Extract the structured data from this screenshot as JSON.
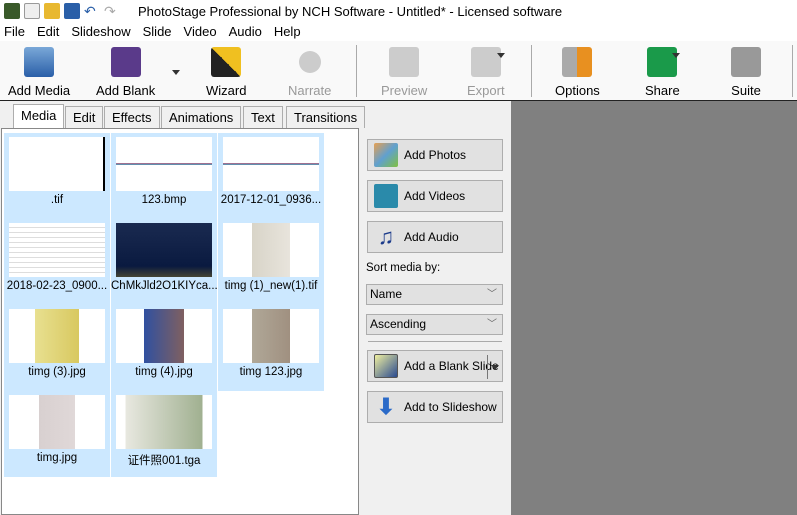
{
  "window": {
    "title": "PhotoStage Professional by NCH Software - Untitled* - Licensed software"
  },
  "menu": [
    "File",
    "Edit",
    "Slideshow",
    "Slide",
    "Video",
    "Audio",
    "Help"
  ],
  "toolbar": {
    "add_media": "Add Media",
    "add_blank": "Add Blank",
    "wizard": "Wizard",
    "narrate": "Narrate",
    "preview": "Preview",
    "export": "Export",
    "options": "Options",
    "share": "Share",
    "suite": "Suite"
  },
  "tabs": [
    "Media",
    "Edit",
    "Effects",
    "Animations",
    "Text",
    "Transitions"
  ],
  "media": [
    ".tif",
    "123.bmp",
    "2017-12-01_0936...",
    "2018-02-23_0900...",
    "ChMkJld2O1KIYca...",
    "timg (1)_new(1).tif",
    "timg (3).jpg",
    "timg (4).jpg",
    "timg 123.jpg",
    "timg.jpg",
    "证件照001.tga"
  ],
  "side": {
    "add_photos": "Add Photos",
    "add_videos": "Add Videos",
    "add_audio": "Add Audio",
    "sort_label": "Sort media by:",
    "sort_by": "Name",
    "sort_order": "Ascending",
    "add_blank_slide": "Add a Blank Slide",
    "add_to_slideshow": "Add to Slideshow"
  }
}
